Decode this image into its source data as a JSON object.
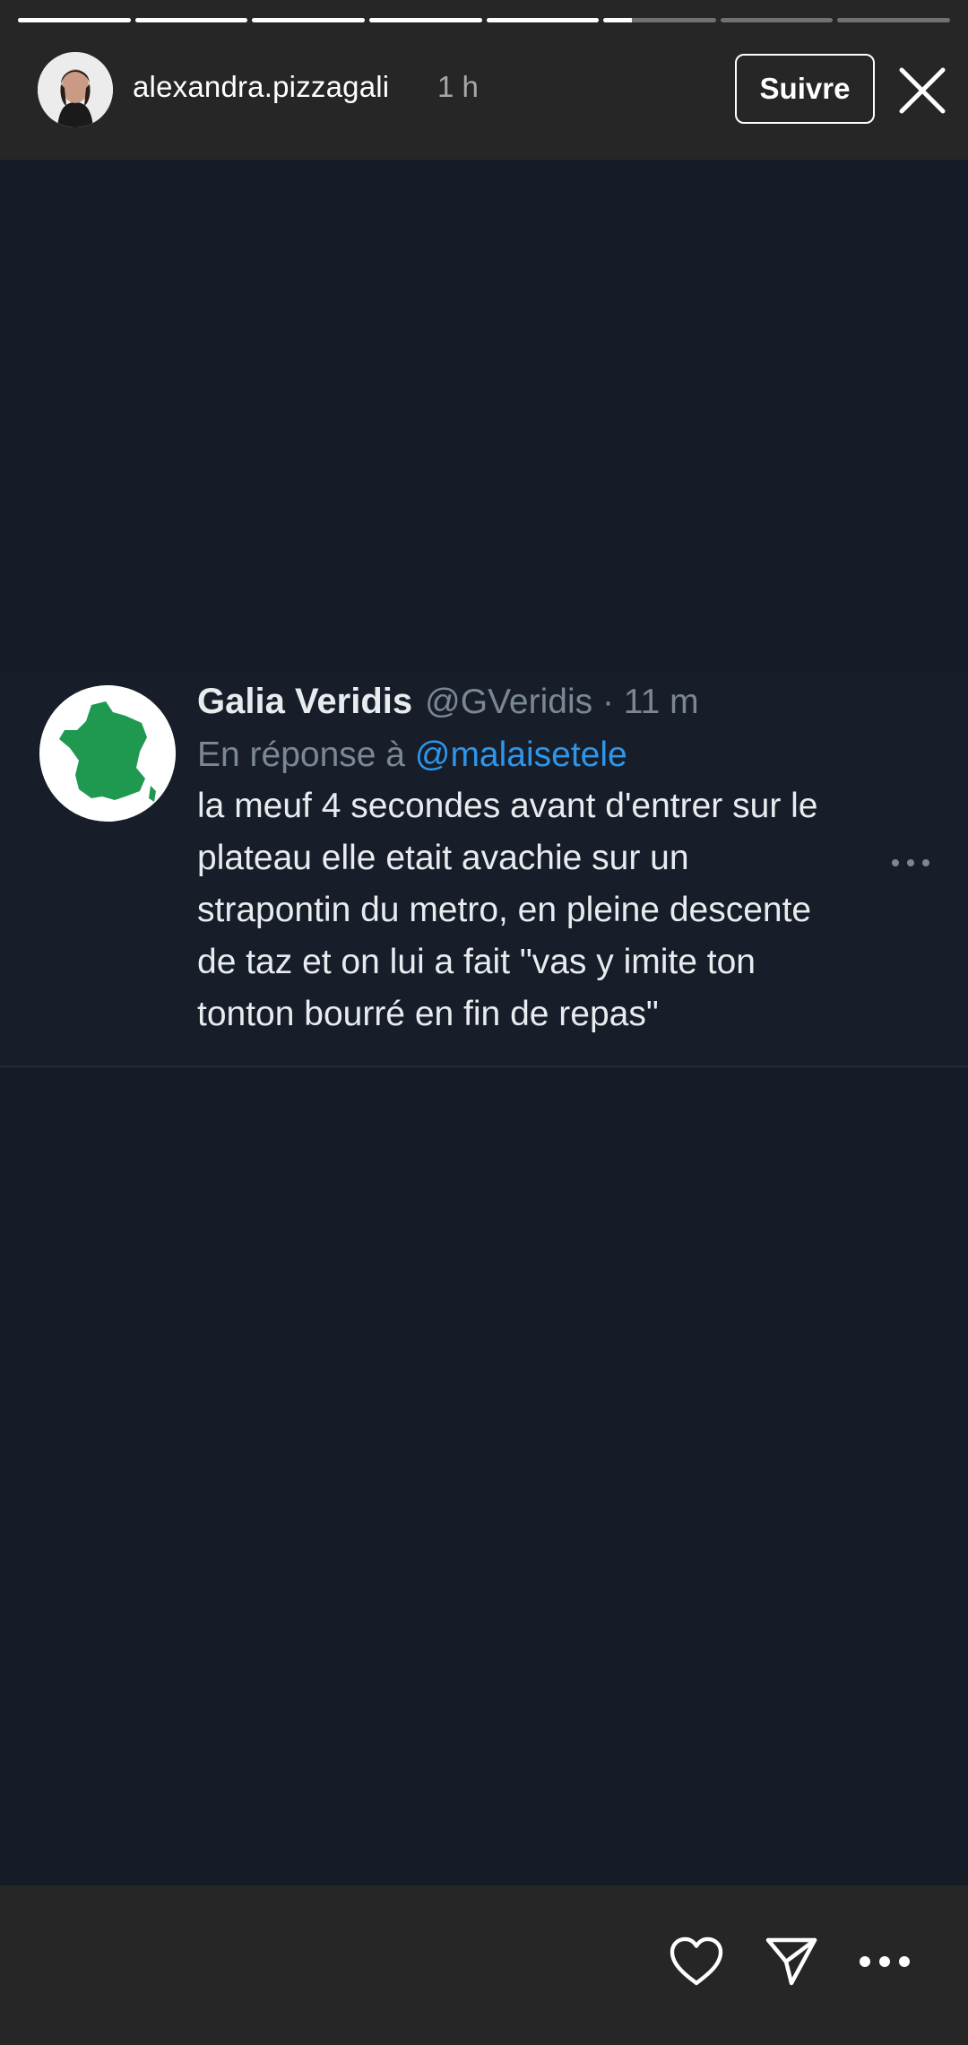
{
  "story": {
    "segments_total": 8,
    "current_segment": 6,
    "current_progress": 0.25
  },
  "header": {
    "username": "alexandra.pizzagali",
    "time_ago": "1 h",
    "follow_label": "Suivre",
    "close_icon": "close-icon"
  },
  "tweet": {
    "author_name": "Galia Veridis",
    "author_handle": "@GVeridis · 11 m",
    "reply_prefix": "En réponse à",
    "reply_mention": "@malaisetele",
    "lines": [
      "la meuf 4 secondes avant d'entrer sur le",
      "plateau elle etait avachie sur un",
      "strapontin du metro, en pleine descente",
      "de taz et on lui a fait \"vas y imite ton",
      "tonton bourré en fin de repas\""
    ],
    "avatar_icon": "france-map-icon",
    "more_icon": "more-dots-icon"
  },
  "footer": {
    "like_icon": "heart-icon",
    "share_icon": "send-icon",
    "more_icon": "more-horizontal-icon"
  },
  "colors": {
    "background": "#151c28",
    "bar": "#262626",
    "mention": "#2e96ea",
    "avatar_green": "#1f9950"
  }
}
